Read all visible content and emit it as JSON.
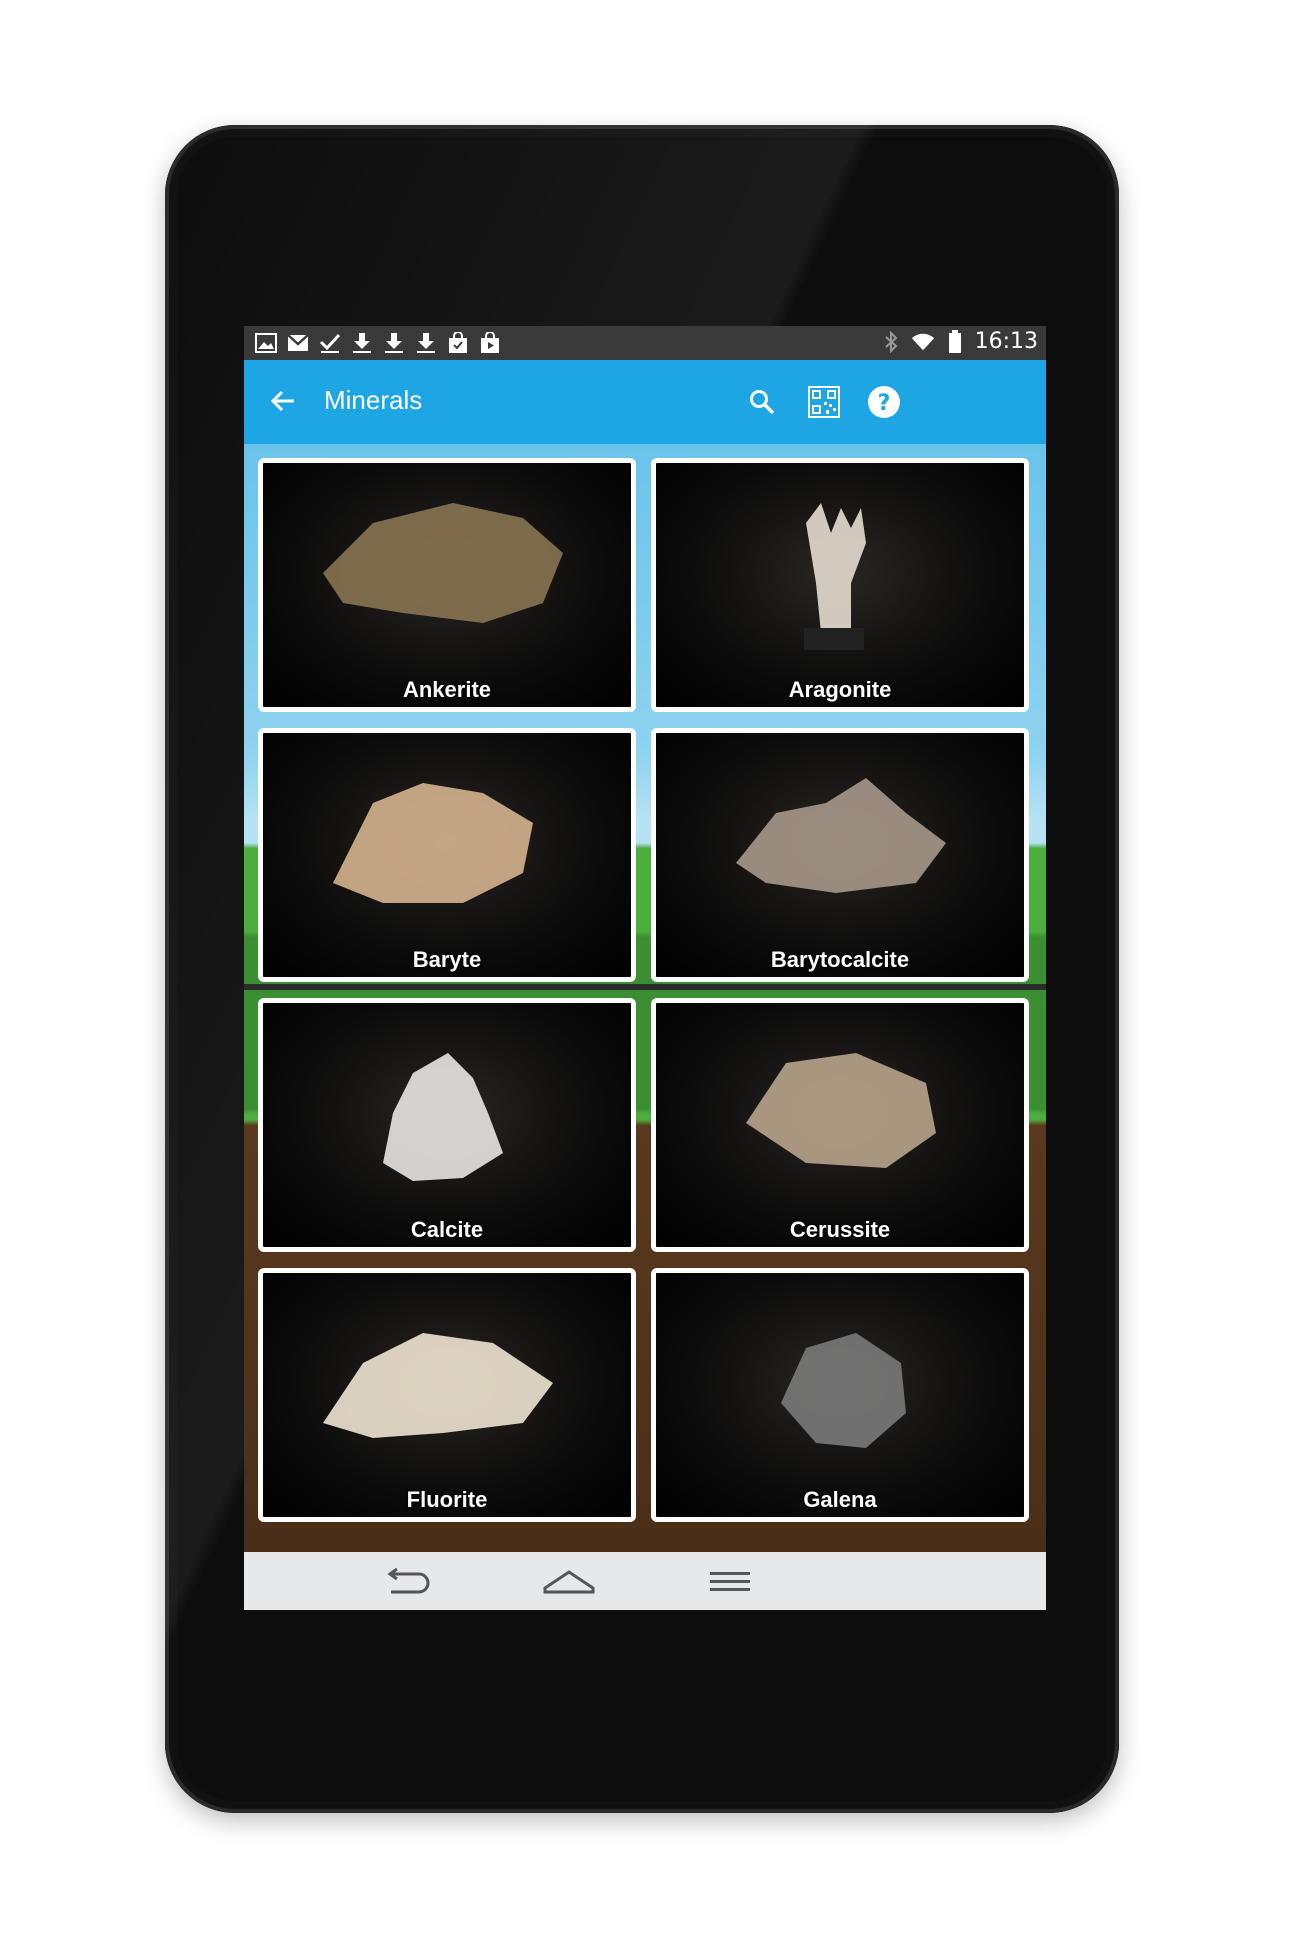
{
  "status_bar": {
    "time": "16:13",
    "left_icons": [
      "image-icon",
      "gmail-icon",
      "check-icon",
      "download-icon",
      "download-icon",
      "download-icon",
      "shopping-bag-icon",
      "play-store-icon"
    ],
    "right_icons": [
      "bluetooth-icon",
      "wifi-icon",
      "battery-icon"
    ]
  },
  "app_bar": {
    "title": "Minerals",
    "actions": [
      "search-icon",
      "qr-code-icon",
      "help-icon"
    ],
    "color": "#1ea5e3"
  },
  "minerals": [
    {
      "name": "Ankerite",
      "color": "#8a7452"
    },
    {
      "name": "Aragonite",
      "color": "#e6ddd0"
    },
    {
      "name": "Baryte",
      "color": "#d6b48e"
    },
    {
      "name": "Barytocalcite",
      "color": "#a7988a"
    },
    {
      "name": "Calcite",
      "color": "#e8e6e4"
    },
    {
      "name": "Cerussite",
      "color": "#b8a48a"
    },
    {
      "name": "Fluorite",
      "color": "#f0e4d2"
    },
    {
      "name": "Galena",
      "color": "#7a7a7a"
    }
  ],
  "nav_bar": [
    "back-icon",
    "home-icon",
    "recents-icon"
  ]
}
